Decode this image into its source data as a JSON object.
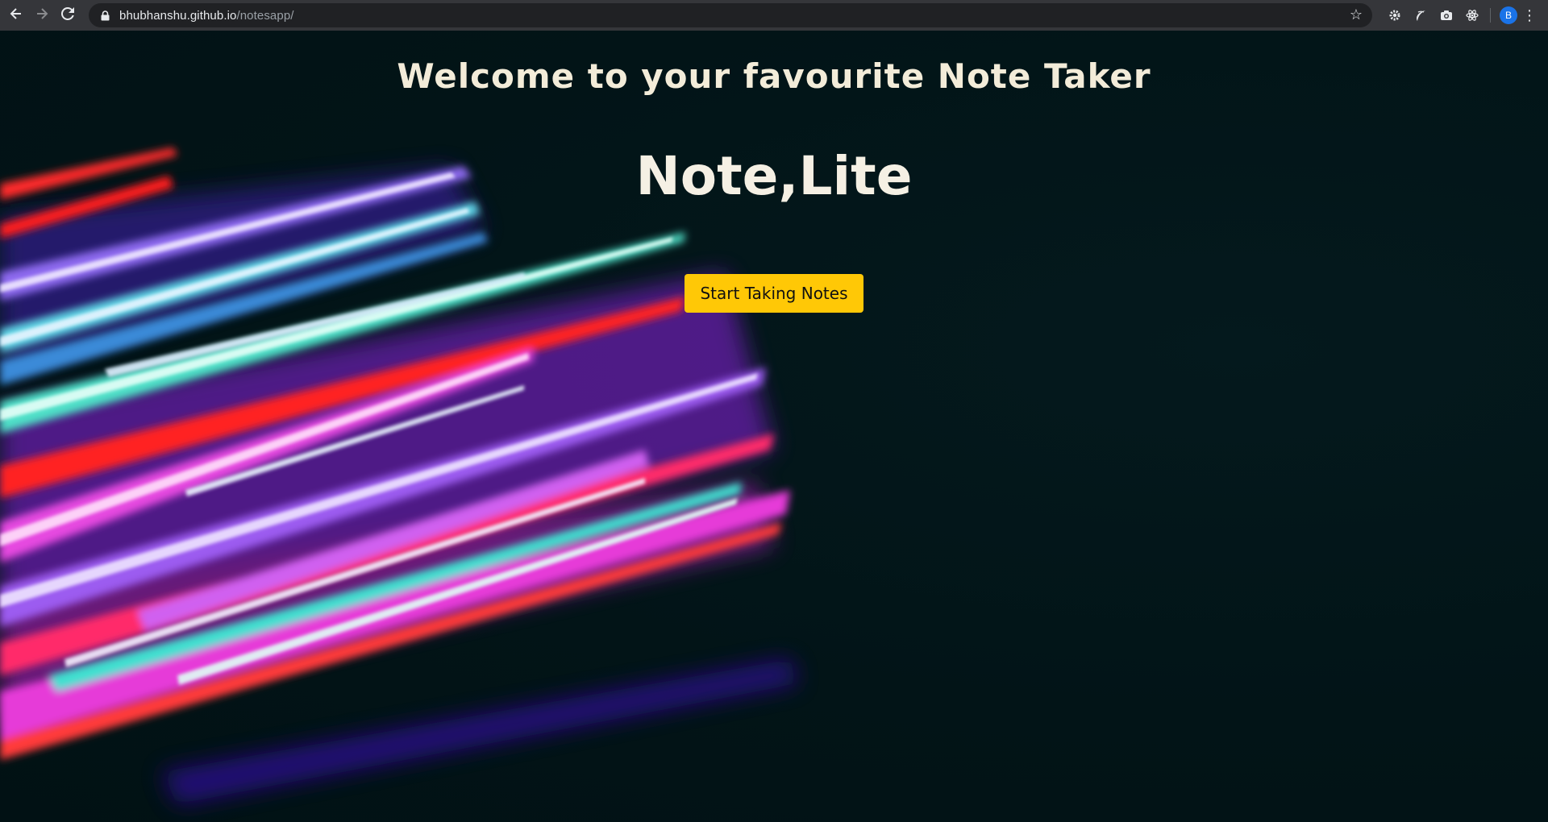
{
  "browser": {
    "url_host": "bhubhanshu.github.io",
    "url_path": "/notesapp/",
    "profile_initial": "B",
    "icons": {
      "back": "arrow-left-icon",
      "forward": "arrow-right-icon",
      "reload": "reload-icon",
      "lock": "lock-icon",
      "bookmark": "star-icon",
      "menu": "kebab-menu-icon"
    },
    "extensions": [
      "gear-extension-icon",
      "leaf-extension-icon",
      "camera-extension-icon",
      "react-extension-icon"
    ]
  },
  "page": {
    "welcome_text": "Welcome to your favourite Note Taker",
    "brand_name": "Note,Lite",
    "cta_label": "Start Taking Notes"
  },
  "colors": {
    "background": "#011418",
    "heading_text": "#f3ecd9",
    "cta_background": "#ffc806",
    "cta_text": "#111111",
    "avatar": "#1a73e8"
  }
}
